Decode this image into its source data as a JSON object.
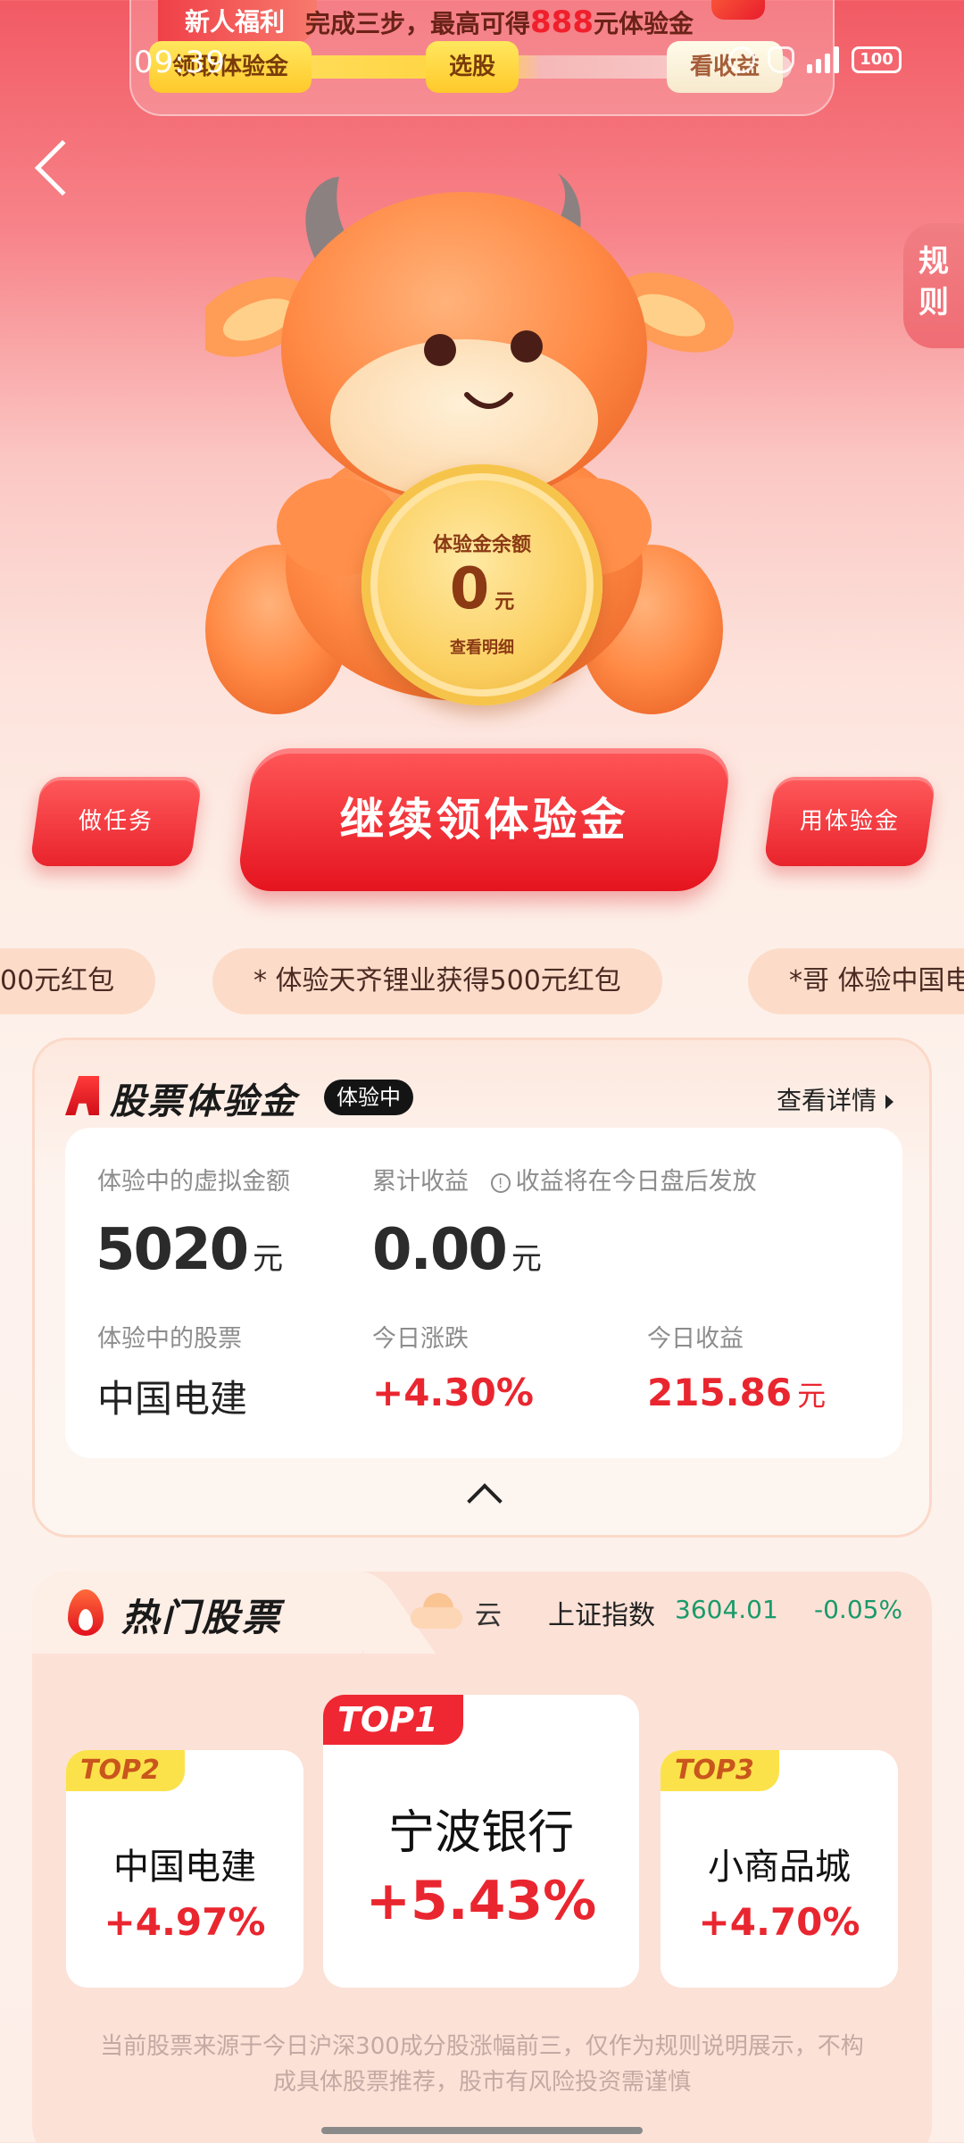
{
  "promo": {
    "tag": "新人福利",
    "text_prefix": "完成三步，最高可得",
    "text_amount": "888",
    "text_suffix": "元体验金",
    "step1": "领取体验金",
    "step2": "选股",
    "step3": "看收益"
  },
  "status_bar": {
    "time": "09:39",
    "battery": "100"
  },
  "rules_label": "规\n则",
  "coin": {
    "title": "体验金余额",
    "amount": "0",
    "unit": "元",
    "link": "查看明细"
  },
  "actions": {
    "task": "做任务",
    "main": "继续领体验金",
    "use": "用体验金"
  },
  "ticker": [
    "00元红包",
    "* 体验天齐锂业获得500元红包",
    "*哥 体验中国电"
  ],
  "experience": {
    "title": "股票体验金",
    "badge": "体验中",
    "detail_link": "查看详情",
    "virtual_amount_label": "体验中的虚拟金额",
    "virtual_amount": "5020",
    "virtual_amount_unit": "元",
    "cum_income_label": "累计收益",
    "income_note": "收益将在今日盘后发放",
    "cum_income": "0.00",
    "cum_income_unit": "元",
    "stock_label": "体验中的股票",
    "stock_name": "中国电建",
    "today_change_label": "今日涨跌",
    "today_change": "+4.30%",
    "today_income_label": "今日收益",
    "today_income": "215.86",
    "today_income_unit": "元"
  },
  "hot": {
    "title": "热门股票",
    "weather": "云",
    "index_name": "上证指数",
    "index_value": "3604.01",
    "index_change": "-0.05%",
    "stocks": [
      {
        "rank": "TOP1",
        "name": "宁波银行",
        "change": "+5.43%"
      },
      {
        "rank": "TOP2",
        "name": "中国电建",
        "change": "+4.97%"
      },
      {
        "rank": "TOP3",
        "name": "小商品城",
        "change": "+4.70%"
      }
    ],
    "disclaimer": "当前股票来源于今日沪深300成分股涨幅前三，仅作为规则说明展示，不构成具体股票推荐，股市有风险投资需谨慎"
  },
  "colors": {
    "primary_red": "#e9262f",
    "index_green": "#1a9a6a",
    "gold": "#fbe24a"
  }
}
